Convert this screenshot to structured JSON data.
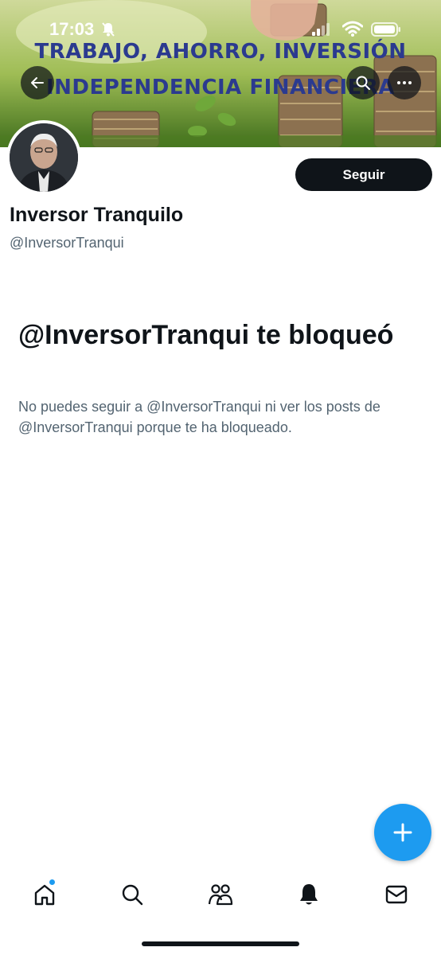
{
  "status_bar": {
    "time": "17:03"
  },
  "banner": {
    "line1": "TRABAJO, AHORRO, INVERSIÓN",
    "line2": "INDEPENDENCIA FINANCIERA"
  },
  "profile": {
    "display_name": "Inversor Tranquilo",
    "handle": "@InversorTranqui",
    "follow_label": "Seguir"
  },
  "blocked": {
    "title": "@InversorTranqui te bloqueó",
    "description": "No puedes seguir a @InversorTranqui ni ver los posts de @InversorTranqui porque te ha bloqueado."
  },
  "colors": {
    "accent": "#1d9bf0",
    "text_primary": "#0f1419",
    "text_secondary": "#536471"
  },
  "icons": {
    "back": "arrow-left-icon",
    "search": "search-icon",
    "more": "more-icon",
    "compose": "plus-icon",
    "nav": [
      "home-icon",
      "search-icon",
      "communities-icon",
      "bell-icon",
      "mail-icon"
    ]
  }
}
